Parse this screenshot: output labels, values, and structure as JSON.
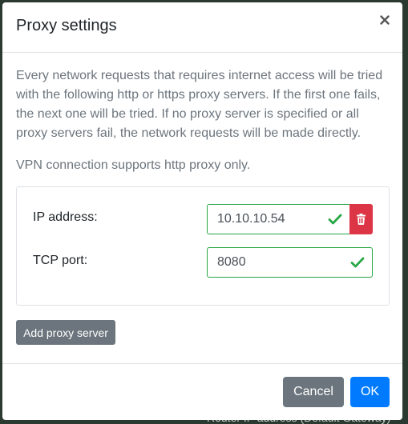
{
  "background": {
    "partial_text": "Router IP address (Default Gateway)"
  },
  "dialog": {
    "title": "Proxy settings",
    "close_label": "×",
    "description": "Every network requests that requires internet access will be tried with the following http or https proxy servers. If the first one fails, the next one will be tried. If no proxy server is specified or all proxy servers fail, the network requests will be made directly.",
    "vpn_note": "VPN connection supports http proxy only.",
    "proxy_servers": [
      {
        "ip_label": "IP address:",
        "ip_value": "10.10.10.54",
        "port_label": "TCP port:",
        "port_value": "8080",
        "ip_valid": true,
        "port_valid": true
      }
    ],
    "add_button_label": "Add proxy server",
    "cancel_label": "Cancel",
    "ok_label": "OK"
  },
  "colors": {
    "valid": "#28a745",
    "danger": "#dc3545",
    "primary": "#007bff",
    "secondary": "#6c757d",
    "muted_text": "#6c757d"
  },
  "icons": {
    "close": "close-icon",
    "valid": "checkmark-icon",
    "delete": "trash-icon"
  }
}
